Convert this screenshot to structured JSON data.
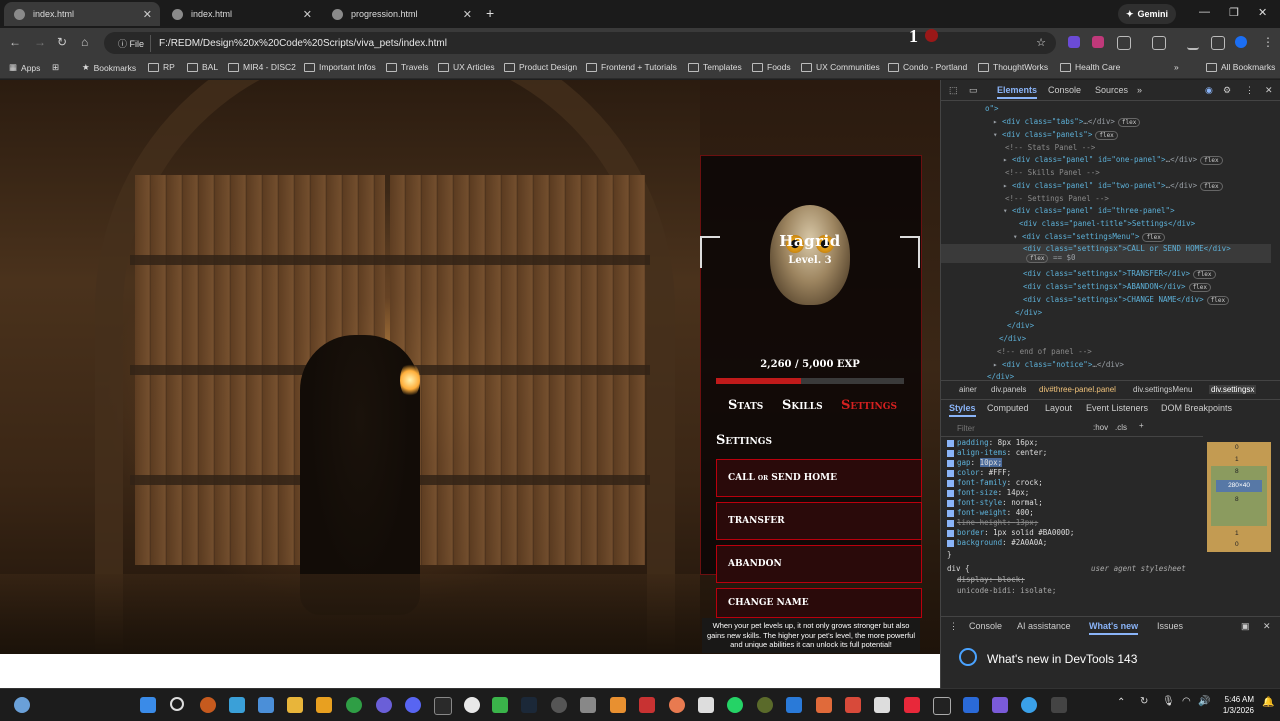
{
  "browser": {
    "tabs": [
      {
        "title": "index.html",
        "active": true
      },
      {
        "title": "index.html",
        "active": false
      },
      {
        "title": "progression.html",
        "active": false
      }
    ],
    "gemini_label": "Gemini",
    "address_chip": "File",
    "url": "F:/REDM/Design%20x%20Code%20Scripts/viva_pets/index.html",
    "bookmarks": [
      "Apps",
      "Bookmarks",
      "RP",
      "BAL",
      "MIR4 - DISC2",
      "Important Infos",
      "Travels",
      "UX Articles",
      "Product Design",
      "Frontend + Tutorials",
      "Templates",
      "Foods",
      "UX Communities",
      "Condo - Portland",
      "ThoughtWorks",
      "Health Care"
    ],
    "all_bookmarks": "All Bookmarks"
  },
  "game": {
    "level_badge": "1",
    "pet_name": "Hagrid",
    "pet_level": "Level. 3",
    "exp_text": "2,260 / 5,000 EXP",
    "exp_fraction": 0.452,
    "tabs": [
      "Stats",
      "Skills",
      "Settings"
    ],
    "active_tab": "Settings",
    "panel_title": "Settings",
    "settings_buttons": [
      "CALL or SEND HOME",
      "TRANSFER",
      "ABANDON",
      "CHANGE NAME"
    ],
    "notice": "When your pet levels up, it not only grows stronger but also gains new skills. The higher your pet's level, the more powerful and unique abilities it can unlock its full potential!"
  },
  "devtools": {
    "tabs": [
      "Elements",
      "Console",
      "Sources"
    ],
    "dom_lines": [
      {
        "text": "o\">"
      },
      {
        "tag": "<div class=\"tabs\">",
        "tail": "…</div>",
        "badge": "flex"
      },
      {
        "tag": "<div class=\"panels\">",
        "badge": "flex"
      },
      {
        "comment": "<!-- Stats Panel -->"
      },
      {
        "tag": "<div class=\"panel\" id=\"one-panel\">",
        "tail": "…</div>",
        "badge": "flex"
      },
      {
        "comment": "<!-- Skills Panel -->"
      },
      {
        "tag": "<div class=\"panel\" id=\"two-panel\">",
        "tail": "…</div>",
        "badge": "flex"
      },
      {
        "comment": "<!-- Settings Panel -->"
      },
      {
        "tag": "<div class=\"panel\" id=\"three-panel\">"
      },
      {
        "tag": "<div class=\"panel-title\">Settings</div>"
      },
      {
        "tag": "<div class=\"settingsMenu\">",
        "badge": "flex"
      },
      {
        "tag": "<div class=\"settingsx\">CALL or SEND HOME</div>",
        "badge": "flex",
        "suffix": "== $0"
      },
      {
        "tag": "<div class=\"settingsx\">TRANSFER</div>",
        "badge": "flex"
      },
      {
        "tag": "<div class=\"settingsx\">ABANDON</div>",
        "badge": "flex"
      },
      {
        "tag": "<div class=\"settingsx\">CHANGE NAME</div>",
        "badge": "flex"
      },
      {
        "tag": "</div>"
      },
      {
        "tag": "</div>"
      },
      {
        "tag": "</div>"
      },
      {
        "comment": "<!-- end of panel -->"
      },
      {
        "tag": "<div class=\"notice\">",
        "tail": "…</div>"
      },
      {
        "tag": "</div>"
      }
    ],
    "breadcrumbs": [
      "ainer",
      "div.panels",
      "div#three-panel.panel",
      "div.settingsMenu",
      "div.settingsx"
    ],
    "style_tabs": [
      "Styles",
      "Computed",
      "Layout",
      "Event Listeners",
      "DOM Breakpoints"
    ],
    "filter_placeholder": "Filter",
    "filter_actions": [
      ":hov",
      ".cls"
    ],
    "css_rules": [
      {
        "prop": "padding",
        "value": "8px 16px;"
      },
      {
        "prop": "align-items",
        "value": "center;"
      },
      {
        "prop": "gap",
        "value": "10px;"
      },
      {
        "prop": "color",
        "value": "#FFF;"
      },
      {
        "prop": "font-family",
        "value": "crock;"
      },
      {
        "prop": "font-size",
        "value": "14px;"
      },
      {
        "prop": "font-style",
        "value": "normal;"
      },
      {
        "prop": "font-weight",
        "value": "400;"
      },
      {
        "prop": "line-height",
        "value": "13px;"
      },
      {
        "prop": "border",
        "value": "1px solid #BA000D;"
      },
      {
        "prop": "background",
        "value": "#2A0A0A;"
      }
    ],
    "ua_selector": "div {",
    "ua_label": "user agent stylesheet",
    "ua_rules": [
      "display: block;",
      "unicode-bidi: isolate;"
    ],
    "box_model": {
      "content": "280×40",
      "padding": "8",
      "border": "1",
      "margin": "0"
    },
    "drawer_tabs": [
      "Console",
      "AI assistance",
      "What's new",
      "Issues"
    ],
    "whats_new_title": "What's new in DevTools 143"
  },
  "taskbar": {
    "time": "5:46 AM",
    "date": "1/3/2026"
  },
  "colors": {
    "accent_red": "#BA000D",
    "exp_fill": "#C01A1A",
    "devtools_link": "#8AB4F8"
  }
}
